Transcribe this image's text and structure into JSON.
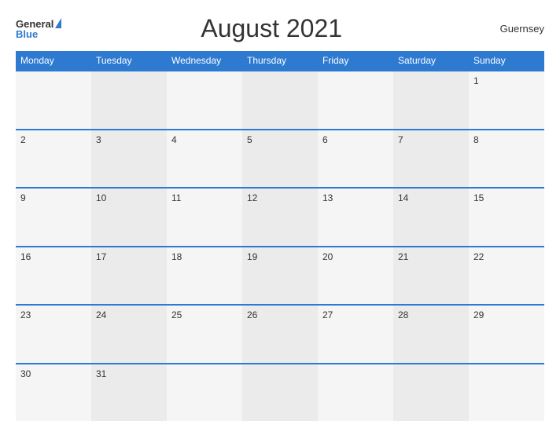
{
  "header": {
    "logo_general": "General",
    "logo_blue": "Blue",
    "title": "August 2021",
    "region": "Guernsey"
  },
  "calendar": {
    "days_of_week": [
      "Monday",
      "Tuesday",
      "Wednesday",
      "Thursday",
      "Friday",
      "Saturday",
      "Sunday"
    ],
    "weeks": [
      [
        "",
        "",
        "",
        "",
        "",
        "",
        "1"
      ],
      [
        "2",
        "3",
        "4",
        "5",
        "6",
        "7",
        "8"
      ],
      [
        "9",
        "10",
        "11",
        "12",
        "13",
        "14",
        "15"
      ],
      [
        "16",
        "17",
        "18",
        "19",
        "20",
        "21",
        "22"
      ],
      [
        "23",
        "24",
        "25",
        "26",
        "27",
        "28",
        "29"
      ],
      [
        "30",
        "31",
        "",
        "",
        "",
        "",
        ""
      ]
    ]
  }
}
